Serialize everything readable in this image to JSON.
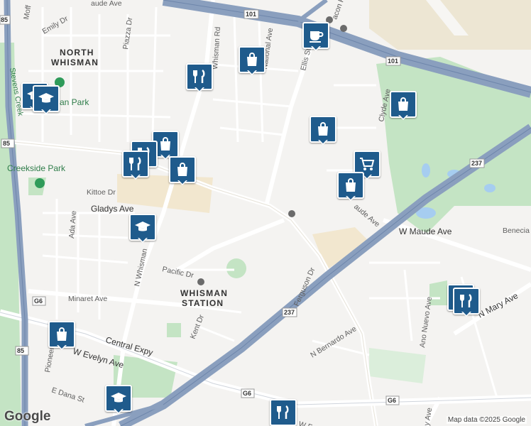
{
  "map": {
    "areas": [
      "NORTH",
      "WHISMAN",
      "WHISMAN",
      "STATION"
    ],
    "parks": [
      "Creekside Park",
      "an Park"
    ],
    "streets": {
      "moffett": "Moff",
      "maude_top": "aude Ave",
      "emily": "Emily Dr",
      "piazza": "Piazza Dr",
      "whisman_rd_top": "Whisman Rd",
      "whisman_rd_mid": "Whisman Rd",
      "national": "National Ave",
      "ellis": "Ellis St",
      "macon": "acon Rd",
      "clyde": "Clyde Ave",
      "kittoe": "Kittoe Dr",
      "gladys": "Gladys Ave",
      "ada": "Ada Ave",
      "whisman_low": "N Whisman",
      "pacific": "Pacific Dr",
      "minaret": "Minaret Ave",
      "kent": "Kent Dr",
      "ferguson": "Ferguson Dr",
      "w_maude": "W Maude Ave",
      "maude_mid": "aude Ave",
      "benecia": "Benecia",
      "n_mary": "N Mary Ave",
      "ano_nuevo": "Ano Nuevo Ave",
      "n_bernardo": "N Bernardo Ave",
      "central": "Central Expy",
      "evelyn": "W Evelyn Ave",
      "pioneer": "Pioneer",
      "e_dana": "E Dana St",
      "stevens_creek": "Stevens Creek",
      "mary_low": "y Ave",
      "fe": "W Fe"
    },
    "shields": [
      "85",
      "101",
      "101",
      "237",
      "237",
      "G6",
      "G6",
      "G6",
      "85",
      "85"
    ],
    "pins": [
      {
        "id": "cafe",
        "icon": "coffee-icon",
        "label": "Cafe"
      },
      {
        "id": "shop1",
        "icon": "shopping-bag-icon",
        "label": "Shop"
      },
      {
        "id": "rest1",
        "icon": "restaurant-icon",
        "label": "Restaurant"
      },
      {
        "id": "school1",
        "icon": "school-icon",
        "label": "School"
      },
      {
        "id": "shop2",
        "icon": "shopping-bag-icon",
        "label": "Shop"
      },
      {
        "id": "shop3",
        "icon": "shopping-bag-icon",
        "label": "Shop"
      },
      {
        "id": "rest2",
        "icon": "restaurant-icon",
        "label": "Restaurant"
      },
      {
        "id": "shop4",
        "icon": "shopping-bag-icon",
        "label": "Shop"
      },
      {
        "id": "shop5",
        "icon": "shopping-bag-icon",
        "label": "Shop"
      },
      {
        "id": "grocery",
        "icon": "shopping-cart-icon",
        "label": "Grocery"
      },
      {
        "id": "shop6",
        "icon": "shopping-bag-icon",
        "label": "Shop"
      },
      {
        "id": "school2",
        "icon": "school-icon",
        "label": "School"
      },
      {
        "id": "shop7",
        "icon": "shopping-bag-icon",
        "label": "Shop"
      },
      {
        "id": "school3",
        "icon": "school-icon",
        "label": "School"
      },
      {
        "id": "rest3",
        "icon": "restaurant-icon",
        "label": "Restaurant"
      },
      {
        "id": "rest4",
        "icon": "restaurant-icon",
        "label": "Restaurant"
      }
    ],
    "colors": {
      "pin": "#1f5b8c",
      "highway": "#8a9fbe",
      "park": "#c4e4c4",
      "water": "#a6cdf0"
    }
  },
  "footer": {
    "logo": "Google",
    "attribution": "Map data ©2025 Google"
  }
}
